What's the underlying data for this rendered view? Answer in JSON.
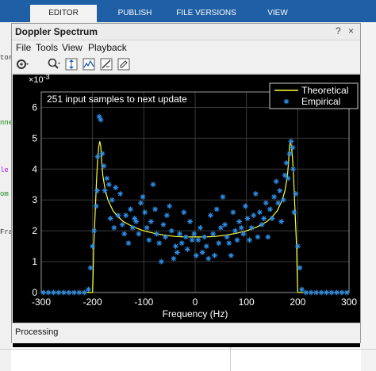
{
  "ribbon": {
    "tabs": [
      "EDITOR",
      "PUBLISH",
      "FILE VERSIONS",
      "VIEW"
    ],
    "active": "EDITOR"
  },
  "background_fragments": [
    "tor",
    "nne",
    "le",
    "om",
    "Fra"
  ],
  "window": {
    "title": "Doppler Spectrum",
    "min_glyph": "?",
    "close_glyph": "×"
  },
  "menu": [
    "File",
    "Tools",
    "View",
    "Playback"
  ],
  "toolbar_icons": [
    "settings-icon",
    "zoom-icon",
    "autoscale-icon",
    "spectrum-icon",
    "measure-icon"
  ],
  "plot": {
    "update_text": "251 input samples to next update",
    "exponent": "×10",
    "exponent_power": "-3",
    "legend": {
      "theoretical": "Theoretical",
      "empirical": "Empirical"
    }
  },
  "status": "Processing",
  "chart_data": {
    "type": "scatter",
    "xlabel": "Frequency (Hz)",
    "ylabel": "",
    "xlim": [
      -300,
      300
    ],
    "ylim": [
      0,
      0.0065
    ],
    "xticks": [
      -300,
      -200,
      -100,
      0,
      100,
      200,
      300
    ],
    "xtick_labels": [
      "-300",
      "-200",
      "-100",
      "0",
      "100",
      "200",
      "300"
    ],
    "yticks": [
      0,
      0.001,
      0.002,
      0.003,
      0.004,
      0.005,
      0.006
    ],
    "ytick_labels": [
      "0",
      "1",
      "2",
      "3",
      "4",
      "5",
      "6"
    ],
    "grid": true,
    "legend_position": "top-right",
    "colors": {
      "theoretical": "#ffff33",
      "empirical": "#2f8fe8"
    },
    "series": [
      {
        "name": "Theoretical",
        "style": "line",
        "x": [
          -300,
          -250,
          -215,
          -208,
          -204,
          -201,
          -200,
          -199,
          -198,
          -196,
          -194,
          -192,
          -190,
          -188,
          -186,
          -184,
          -182,
          -180,
          -175,
          -170,
          -160,
          -150,
          -140,
          -120,
          -100,
          -80,
          -60,
          -40,
          -20,
          0,
          20,
          40,
          60,
          80,
          100,
          120,
          140,
          150,
          160,
          170,
          175,
          180,
          182,
          184,
          186,
          188,
          190,
          192,
          194,
          196,
          198,
          199,
          200,
          201,
          204,
          208,
          215,
          250,
          300
        ],
        "y": [
          0,
          0,
          0,
          0,
          0,
          0,
          1e-05,
          0.0005,
          0.0014,
          0.0022,
          0.0029,
          0.0037,
          0.0043,
          0.0047,
          0.0049,
          0.00475,
          0.0042,
          0.0038,
          0.0033,
          0.003,
          0.00265,
          0.00245,
          0.0023,
          0.00212,
          0.002,
          0.00192,
          0.00186,
          0.00182,
          0.0018,
          0.0018,
          0.0018,
          0.00182,
          0.00186,
          0.00192,
          0.002,
          0.00212,
          0.0023,
          0.00245,
          0.00265,
          0.003,
          0.0033,
          0.0038,
          0.0042,
          0.00475,
          0.0049,
          0.0047,
          0.0043,
          0.0037,
          0.0029,
          0.0022,
          0.0014,
          0.0005,
          1e-05,
          0,
          0,
          0,
          0,
          0,
          0
        ]
      },
      {
        "name": "Empirical",
        "style": "markers",
        "marker": "asterisk",
        "x": [
          -296,
          -286,
          -276,
          -266,
          -256,
          -246,
          -236,
          -226,
          -216,
          -208,
          -204,
          -200,
          -197,
          -193,
          -191,
          -190,
          -187,
          -184,
          -181,
          -178,
          -176,
          -172,
          -168,
          -165,
          -162,
          -158,
          -155,
          -150,
          -146,
          -142,
          -138,
          -135,
          -130,
          -126,
          -122,
          -118,
          -115,
          -110,
          -106,
          -102,
          -98,
          -94,
          -90,
          -86,
          -82,
          -78,
          -75,
          -70,
          -66,
          -62,
          -58,
          -55,
          -50,
          -46,
          -42,
          -38,
          -35,
          -30,
          -26,
          -22,
          -18,
          -15,
          -10,
          -6,
          -2,
          2,
          6,
          10,
          14,
          18,
          22,
          26,
          30,
          35,
          38,
          42,
          46,
          50,
          54,
          58,
          62,
          66,
          70,
          74,
          78,
          82,
          86,
          90,
          94,
          98,
          102,
          106,
          110,
          114,
          118,
          122,
          126,
          130,
          134,
          138,
          142,
          146,
          150,
          154,
          158,
          162,
          165,
          168,
          172,
          175,
          178,
          181,
          184,
          187,
          190,
          191,
          193,
          196,
          200,
          204,
          208,
          216,
          226,
          236,
          246,
          256,
          266,
          276,
          286,
          296
        ],
        "y": [
          0,
          0,
          0,
          0,
          0,
          0,
          0,
          0,
          0,
          0.0001,
          0.0008,
          0.0015,
          0.002,
          0.0028,
          0.0033,
          0.0044,
          0.0057,
          0.0056,
          0.0045,
          0.0041,
          0.0033,
          0.0037,
          0.0035,
          0.0024,
          0.003,
          0.0021,
          0.0034,
          0.0025,
          0.0032,
          0.0022,
          0.0019,
          0.0025,
          0.0016,
          0.0027,
          0.0021,
          0.0024,
          0.0023,
          0.0019,
          0.0029,
          0.0031,
          0.0026,
          0.0021,
          0.0017,
          0.0023,
          0.0035,
          0.0027,
          0.0019,
          0.0016,
          0.001,
          0.0022,
          0.0018,
          0.0025,
          0.0028,
          0.002,
          0.0011,
          0.0015,
          0.0013,
          0.0019,
          0.0016,
          0.0026,
          0.0018,
          0.0014,
          0.0023,
          0.0017,
          0.0019,
          0.0012,
          0.0017,
          0.0021,
          0.0013,
          0.0018,
          0.0015,
          0.0011,
          0.0025,
          0.0019,
          0.0012,
          0.0027,
          0.0016,
          0.0021,
          0.0031,
          0.0022,
          0.0018,
          0.0016,
          0.0012,
          0.0026,
          0.002,
          0.0017,
          0.0023,
          0.0021,
          0.0019,
          0.0028,
          0.0024,
          0.0017,
          0.0021,
          0.0025,
          0.0032,
          0.0018,
          0.0026,
          0.0022,
          0.0024,
          0.0029,
          0.0018,
          0.0027,
          0.0024,
          0.0031,
          0.0036,
          0.0029,
          0.0033,
          0.0023,
          0.003,
          0.0038,
          0.0042,
          0.0037,
          0.0045,
          0.0049,
          0.0047,
          0.004,
          0.0026,
          0.0032,
          0.0015,
          0.0008,
          0.0001,
          0,
          0,
          0,
          0,
          0,
          0,
          0,
          0,
          0
        ]
      }
    ]
  }
}
